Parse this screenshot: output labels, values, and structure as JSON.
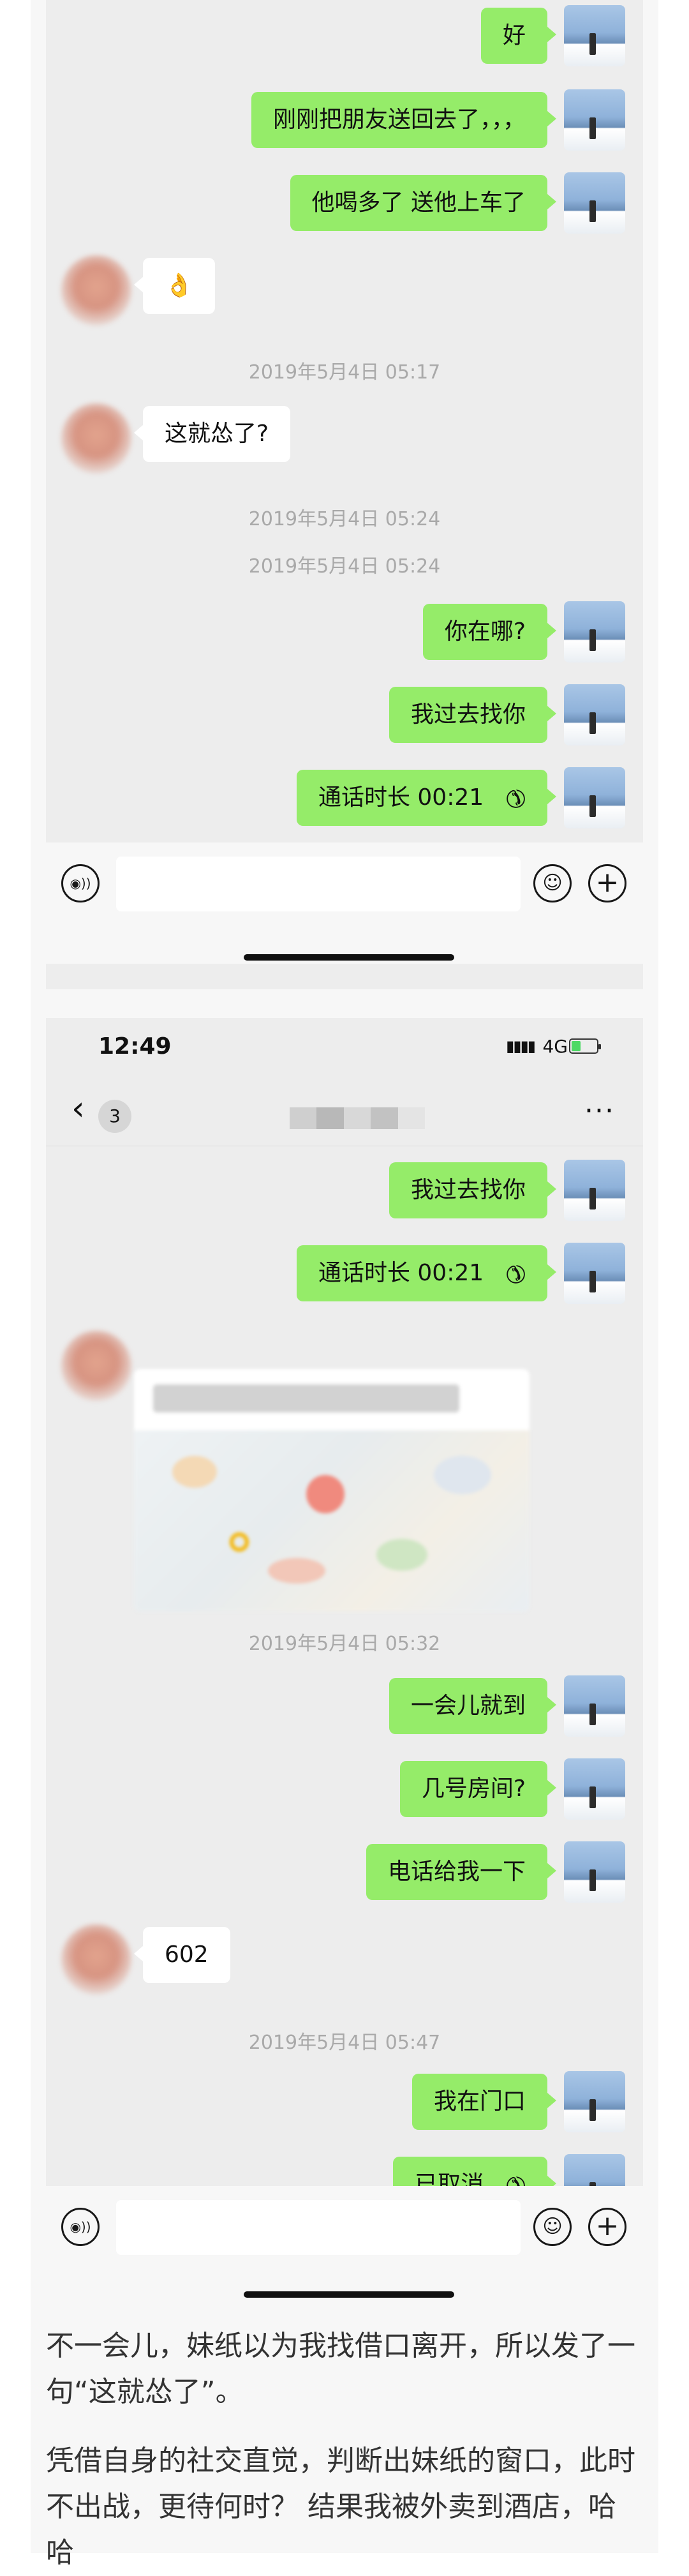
{
  "phone1": {
    "messages": [
      {
        "type": "out",
        "text": "好"
      },
      {
        "type": "out",
        "text": "刚刚把朋友送回去了，，，"
      },
      {
        "type": "out",
        "text": "他喝多了  送他上车了"
      },
      {
        "type": "in",
        "text": "👌"
      },
      {
        "type": "time",
        "text": "2019年5月4日 05:17"
      },
      {
        "type": "in",
        "text": "这就怂了?"
      },
      {
        "type": "time",
        "text": "2019年5月4日 05:24"
      },
      {
        "type": "time",
        "text": "2019年5月4日 05:24"
      },
      {
        "type": "out",
        "text": "你在哪?"
      },
      {
        "type": "out",
        "text": "我过去找你"
      },
      {
        "type": "out_call",
        "text": "通话时长 00:21"
      }
    ],
    "input_placeholder": ""
  },
  "phone2": {
    "status": {
      "time": "12:49",
      "signal_icon": "▮▮▮▮",
      "network": "4G",
      "battery_icon": "battery-charging-icon"
    },
    "nav": {
      "back_icon": "‹",
      "unread_count": "3",
      "more_icon": "···"
    },
    "messages": [
      {
        "type": "out",
        "text": "我过去找你"
      },
      {
        "type": "out_call",
        "text": "通话时长 00:21"
      },
      {
        "type": "location"
      },
      {
        "type": "time",
        "text": "2019年5月4日 05:32"
      },
      {
        "type": "out",
        "text": "一会儿就到"
      },
      {
        "type": "out",
        "text": "几号房间?"
      },
      {
        "type": "out",
        "text": "电话给我一下"
      },
      {
        "type": "in",
        "text": "602"
      },
      {
        "type": "time",
        "text": "2019年5月4日 05:47"
      },
      {
        "type": "out",
        "text": "我在门口"
      },
      {
        "type": "out_call",
        "text": "已取消"
      }
    ],
    "input_placeholder": ""
  },
  "icons": {
    "call": "✆",
    "voice": "◉))",
    "emoji": "☺",
    "plus": "+"
  },
  "article": {
    "para1": "  不一会儿，妹纸以为我找借口离开，所以发了一句“这就怂了”。",
    "para2": "凭借自身的社交直觉，判断出妹纸的窗口，此时不出战，更待何时？ 结果我被外卖到酒店，哈哈"
  }
}
